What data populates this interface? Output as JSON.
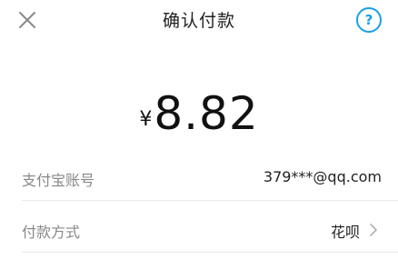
{
  "header": {
    "title": "确认付款",
    "close_icon": "close-icon",
    "help_icon": "question-circle-icon",
    "help_glyph": "?"
  },
  "payment": {
    "currency_symbol": "¥",
    "amount": "8.82"
  },
  "rows": [
    {
      "label": "支付宝账号",
      "value": "379***@qq.com"
    },
    {
      "label": "付款方式",
      "value": "花呗",
      "chevron_icon": "chevron-right-icon"
    }
  ],
  "colors": {
    "accent": "#1aa0e6",
    "text_primary": "#222222",
    "text_secondary": "#888888"
  }
}
